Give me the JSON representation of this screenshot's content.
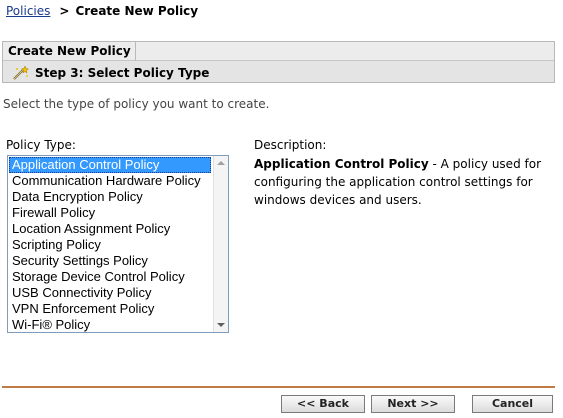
{
  "breadcrumb": {
    "parent": "Policies",
    "separator": ">",
    "current": "Create New Policy"
  },
  "panel": {
    "tab_title": "Create New Policy",
    "step_icon": "wand-icon",
    "step_title": "Step 3: Select Policy Type"
  },
  "instruction": "Select the type of policy you want to create.",
  "policy_type": {
    "label": "Policy Type:",
    "selected": "Application Control Policy",
    "options": [
      "Application Control Policy",
      "Communication Hardware Policy",
      "Data Encryption Policy",
      "Firewall Policy",
      "Location Assignment Policy",
      "Scripting Policy",
      "Security Settings Policy",
      "Storage Device Control Policy",
      "USB Connectivity Policy",
      "VPN Enforcement Policy",
      "Wi-Fi® Policy"
    ]
  },
  "description": {
    "label": "Description:",
    "name": "Application Control Policy",
    "text": " - A policy used for configuring the application control settings for windows devices and users."
  },
  "buttons": {
    "back": "<< Back",
    "next": "Next >>",
    "cancel": "Cancel"
  },
  "colors": {
    "selection": "#3399ff",
    "divider": "#c07a46",
    "link": "#1a3a8a"
  }
}
